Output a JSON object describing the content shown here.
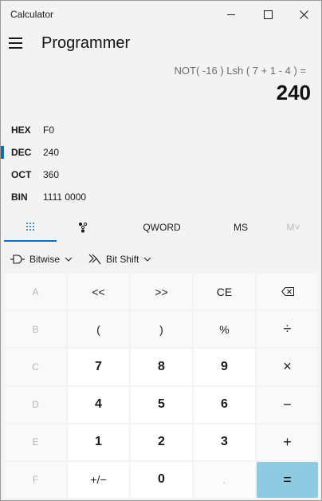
{
  "window": {
    "title": "Calculator",
    "controls": {
      "minimize": "—",
      "maximize": "☐",
      "close": "✕"
    }
  },
  "header": {
    "mode_title": "Programmer"
  },
  "display": {
    "expression": "NOT( -16 ) Lsh ( 7 + 1 - 4 ) =",
    "result": "240"
  },
  "radix": [
    {
      "label": "HEX",
      "value": "F0",
      "active": false
    },
    {
      "label": "DEC",
      "value": "240",
      "active": true
    },
    {
      "label": "OCT",
      "value": "360",
      "active": false
    },
    {
      "label": "BIN",
      "value": "1111 0000",
      "active": false
    }
  ],
  "tabs": {
    "keypad_icon": "full-keypad-icon",
    "bits_icon": "bit-toggle-icon",
    "word_size": "QWORD",
    "ms": "MS",
    "m_dropdown": "M˅"
  },
  "tools": {
    "bitwise": "Bitwise",
    "bit_shift": "Bit Shift"
  },
  "keys": [
    [
      "A",
      "<<",
      ">>",
      "CE",
      "⌫"
    ],
    [
      "B",
      "(",
      ")",
      "%",
      "÷"
    ],
    [
      "C",
      "7",
      "8",
      "9",
      "×"
    ],
    [
      "D",
      "4",
      "5",
      "6",
      "−"
    ],
    [
      "E",
      "1",
      "2",
      "3",
      "+"
    ],
    [
      "F",
      "+/−",
      "0",
      ".",
      "="
    ]
  ],
  "colors": {
    "accent": "#0f6cbd",
    "equals_bg": "#8ecbe0"
  }
}
